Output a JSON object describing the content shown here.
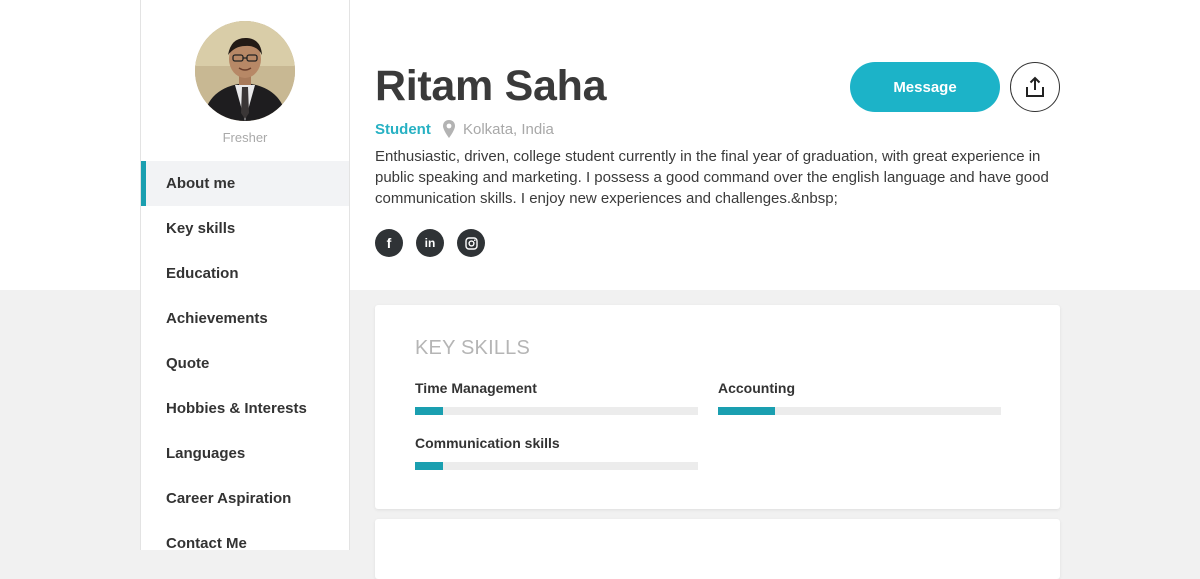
{
  "profile": {
    "name": "Ritam Saha",
    "role": "Student",
    "subtitle": "Fresher",
    "location": "Kolkata, India",
    "bio": "Enthusiastic, driven, college student currently in the final year of graduation, with great experience in public speaking and marketing. I possess a good command over the english language and have good communication skills. I enjoy new experiences and challenges.&nbsp;"
  },
  "actions": {
    "message_label": "Message",
    "share_icon": "share-icon"
  },
  "social": [
    {
      "icon": "facebook-icon",
      "glyph": "f"
    },
    {
      "icon": "linkedin-icon",
      "glyph": "in"
    },
    {
      "icon": "instagram-icon",
      "glyph": ""
    }
  ],
  "sidebar": {
    "items": [
      {
        "label": "About me",
        "active": true
      },
      {
        "label": "Key skills"
      },
      {
        "label": "Education"
      },
      {
        "label": "Achievements"
      },
      {
        "label": "Quote"
      },
      {
        "label": "Hobbies & Interests"
      },
      {
        "label": "Languages"
      },
      {
        "label": "Career Aspiration"
      },
      {
        "label": "Contact Me"
      }
    ]
  },
  "key_skills": {
    "title": "KEY SKILLS",
    "skills": [
      {
        "name": "Time Management",
        "level": 0.1
      },
      {
        "name": "Accounting",
        "level": 0.2
      },
      {
        "name": "Communication skills",
        "level": 0.1
      }
    ]
  },
  "colors": {
    "accent": "#1cb3c8",
    "bar": "#1a9fb0",
    "role": "#27b1c3",
    "social_bg": "#2f3336"
  }
}
